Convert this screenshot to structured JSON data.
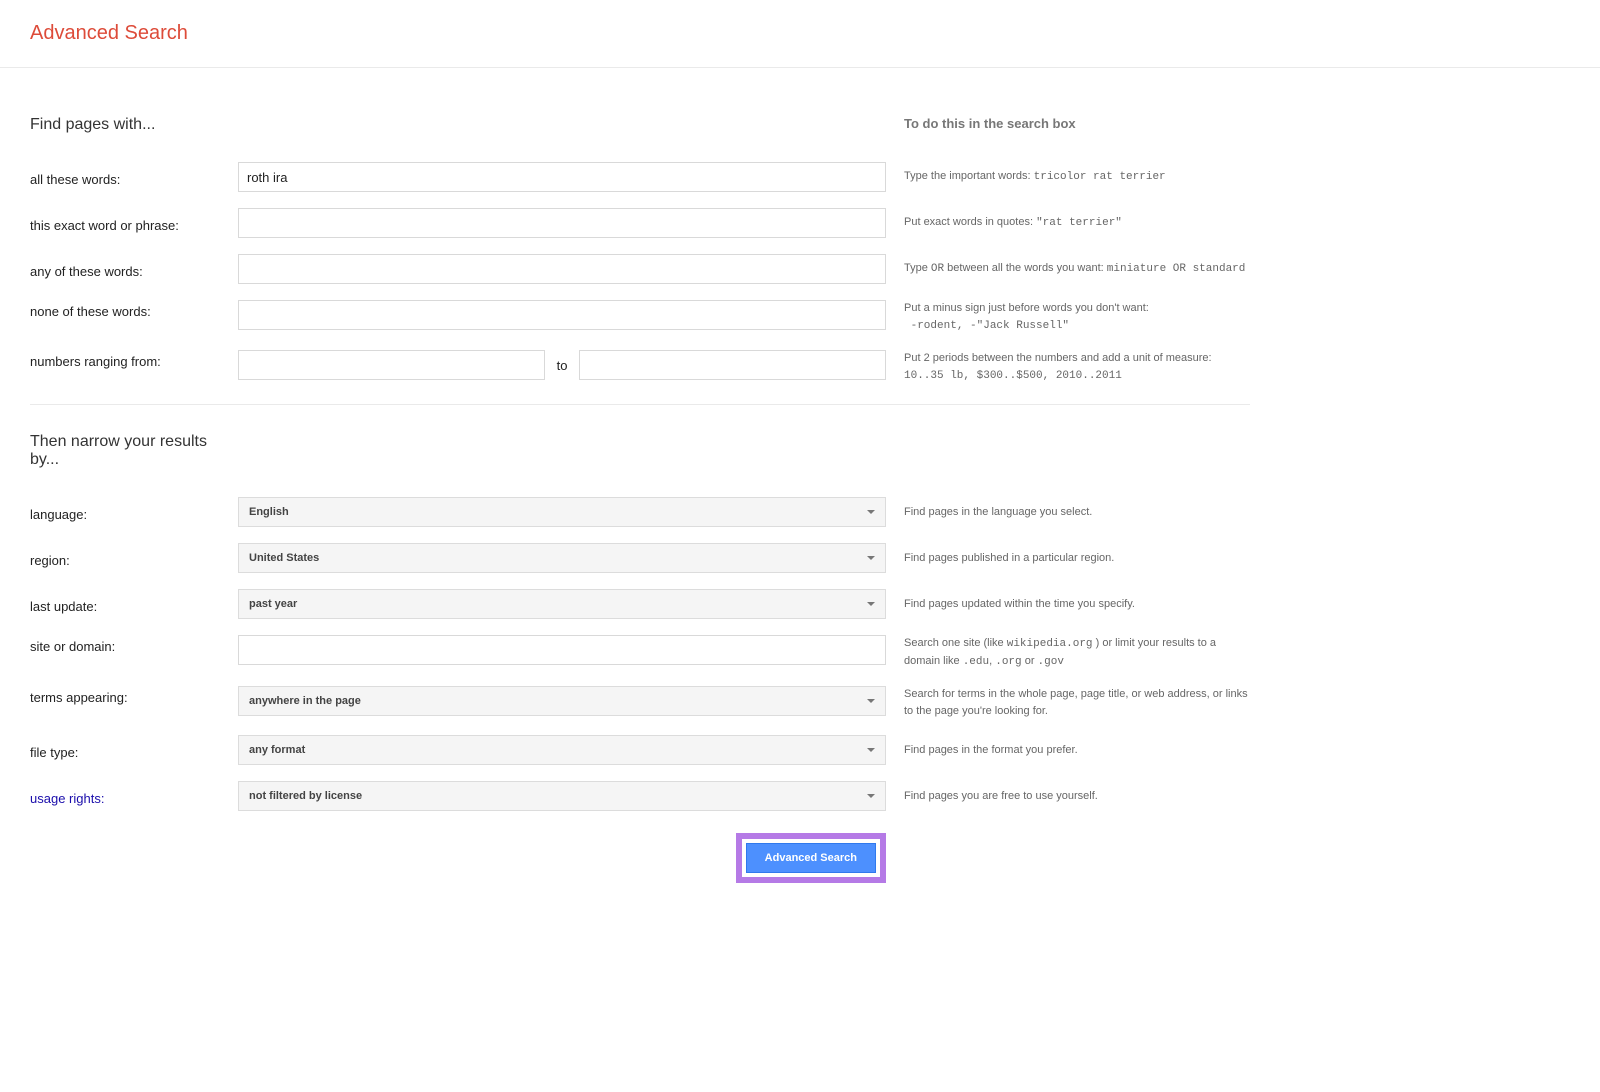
{
  "page": {
    "title": "Advanced Search"
  },
  "section1": {
    "heading": "Find pages with...",
    "help_header": "To do this in the search box",
    "rows": {
      "all_words": {
        "label": "all these words:",
        "value": "roth ira",
        "help_pre": "Type the important words: ",
        "help_code": "tricolor rat terrier"
      },
      "exact": {
        "label": "this exact word or phrase:",
        "value": "",
        "help_pre": "Put exact words in quotes: ",
        "help_code": "\"rat terrier\""
      },
      "any_words": {
        "label": "any of these words:",
        "value": "",
        "help_pre": "Type ",
        "help_or": "OR",
        "help_mid": " between all the words you want: ",
        "help_code": "miniature OR standard"
      },
      "none_words": {
        "label": "none of these words:",
        "value": "",
        "help_line1": "Put a minus sign just before words you don't want:",
        "help_code": "-rodent, -\"Jack Russell\""
      },
      "range": {
        "label": "numbers ranging from:",
        "from": "",
        "to_label": "to",
        "to": "",
        "help_line1": "Put 2 periods between the numbers and add a unit of measure:",
        "help_code": "10..35 lb, $300..$500, 2010..2011"
      }
    }
  },
  "section2": {
    "heading": "Then narrow your results by...",
    "rows": {
      "language": {
        "label": "language:",
        "value": "English",
        "help": "Find pages in the language you select."
      },
      "region": {
        "label": "region:",
        "value": "United States",
        "help": "Find pages published in a particular region."
      },
      "last_update": {
        "label": "last update:",
        "value": "past year",
        "help": "Find pages updated within the time you specify."
      },
      "site": {
        "label": "site or domain:",
        "value": "",
        "help_pre": "Search one site (like ",
        "help_code": "wikipedia.org",
        "help_mid": " ) or limit your results to a domain like ",
        "help_code2": ".edu",
        "help_sep1": ", ",
        "help_code3": ".org",
        "help_sep2": " or ",
        "help_code4": ".gov"
      },
      "terms": {
        "label": "terms appearing:",
        "value": "anywhere in the page",
        "help": "Search for terms in the whole page, page title, or web address, or links to the page you're looking for."
      },
      "filetype": {
        "label": "file type:",
        "value": "any format",
        "help": "Find pages in the format you prefer."
      },
      "usage": {
        "label": "usage rights:",
        "value": "not filtered by license",
        "help": "Find pages you are free to use yourself."
      }
    }
  },
  "submit": {
    "label": "Advanced Search"
  }
}
